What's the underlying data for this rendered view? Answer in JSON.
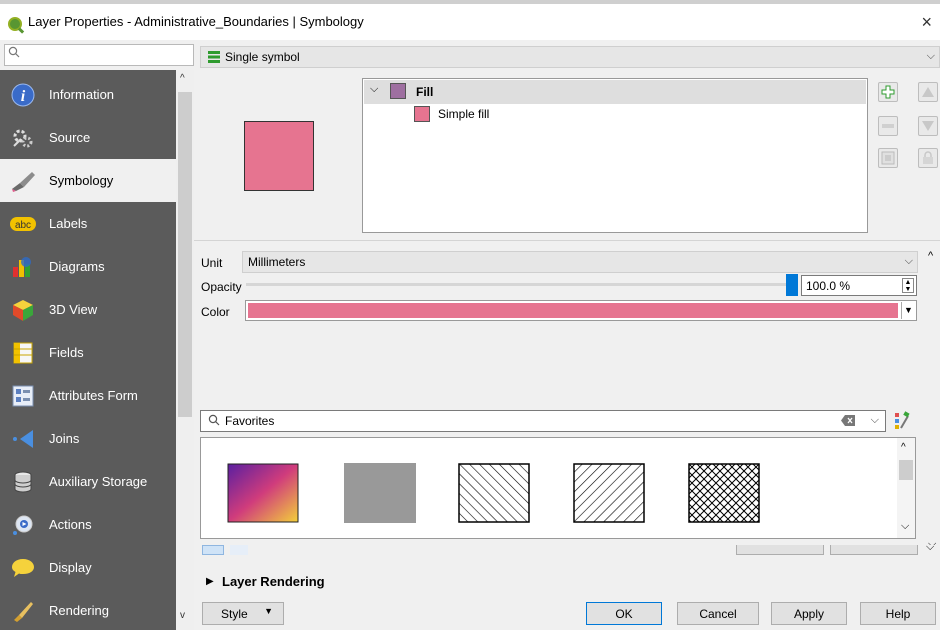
{
  "window": {
    "title": "Layer Properties - Administrative_Boundaries | Symbology",
    "close_glyph": "×"
  },
  "sidebar": {
    "search_placeholder": "",
    "items": [
      {
        "label": "Information",
        "icon": "information-icon"
      },
      {
        "label": "Source",
        "icon": "source-icon"
      },
      {
        "label": "Symbology",
        "icon": "symbology-icon",
        "active": true
      },
      {
        "label": "Labels",
        "icon": "labels-icon"
      },
      {
        "label": "Diagrams",
        "icon": "diagrams-icon"
      },
      {
        "label": "3D View",
        "icon": "3d-view-icon"
      },
      {
        "label": "Fields",
        "icon": "fields-icon"
      },
      {
        "label": "Attributes Form",
        "icon": "attributes-form-icon"
      },
      {
        "label": "Joins",
        "icon": "joins-icon"
      },
      {
        "label": "Auxiliary Storage",
        "icon": "auxiliary-storage-icon"
      },
      {
        "label": "Actions",
        "icon": "actions-icon"
      },
      {
        "label": "Display",
        "icon": "display-icon"
      },
      {
        "label": "Rendering",
        "icon": "rendering-icon"
      }
    ],
    "labels_badge": "abc"
  },
  "symbology": {
    "renderer": "Single symbol",
    "tree": {
      "root": "Fill",
      "child": "Simple fill"
    },
    "unit_label": "Unit",
    "unit_value": "Millimeters",
    "opacity_label": "Opacity",
    "opacity_value": "100.0 %",
    "opacity_fraction": 1.0,
    "color_label": "Color",
    "symbol_color": "#e67490",
    "fill_swatch_color": "#9e6fa0",
    "style_search_value": "Favorites",
    "layer_rendering_label": "Layer Rendering"
  },
  "buttons": {
    "style": "Style",
    "ok": "OK",
    "cancel": "Cancel",
    "apply": "Apply",
    "help": "Help"
  }
}
